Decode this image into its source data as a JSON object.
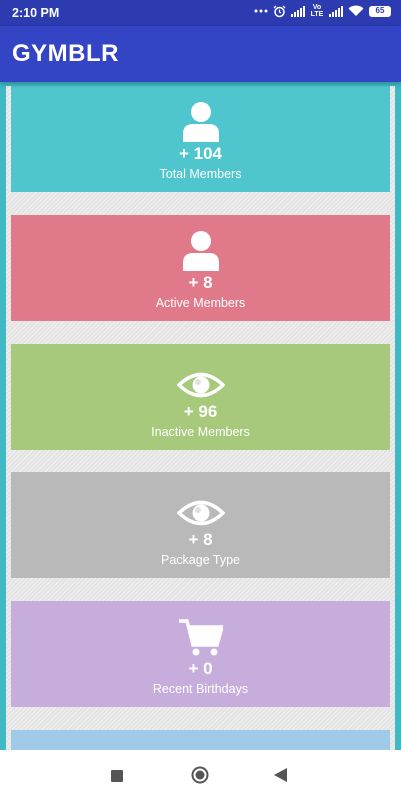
{
  "status_bar": {
    "time": "2:10 PM",
    "network_label": "Vo LTE",
    "battery": "65"
  },
  "app_bar": {
    "title": "GYMBLR"
  },
  "colors": {
    "status_bar": "#2c3bb0",
    "app_bar": "#3344c4",
    "frame": "#40b9c5"
  },
  "cards": [
    {
      "icon": "person-icon",
      "count": "+ 104",
      "label": "Total Members",
      "color": "#4fc5cd"
    },
    {
      "icon": "person-icon",
      "count": "+ 8",
      "label": "Active Members",
      "color": "#e0798a"
    },
    {
      "icon": "eye-icon",
      "count": "+ 96",
      "label": "Inactive Members",
      "color": "#a7c97c"
    },
    {
      "icon": "eye-icon",
      "count": "+ 8",
      "label": "Package Type",
      "color": "#b9b9b9"
    },
    {
      "icon": "cart-icon",
      "count": "+ 0",
      "label": "Recent Birthdays",
      "color": "#c6addc"
    },
    {
      "icon": "eye-icon",
      "count": "",
      "label": "",
      "color": "#9fcbe8"
    }
  ],
  "navigation": {
    "recents": "recents-square-icon",
    "home": "home-circle-icon",
    "back": "back-triangle-icon"
  }
}
